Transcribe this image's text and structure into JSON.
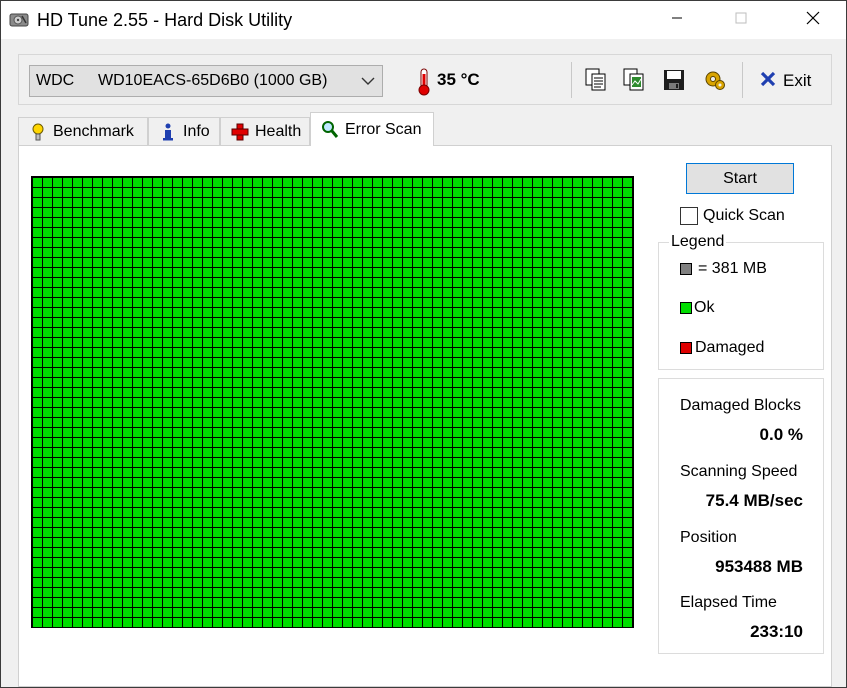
{
  "window": {
    "title": "HD Tune 2.55 - Hard Disk Utility"
  },
  "toolbar": {
    "drive_vendor": "WDC",
    "drive_model": "WD10EACS-65D6B0 (1000 GB)",
    "temperature": "35 °C",
    "exit_label": "Exit",
    "icons": [
      "copy-text-icon",
      "copy-screenshot-icon",
      "save-icon",
      "options-icon"
    ]
  },
  "tabs": [
    {
      "label": "Benchmark",
      "icon": "benchmark-icon"
    },
    {
      "label": "Info",
      "icon": "info-icon"
    },
    {
      "label": "Health",
      "icon": "health-icon"
    },
    {
      "label": "Error Scan",
      "icon": "magnifier-icon",
      "active": true
    }
  ],
  "scan": {
    "start_label": "Start",
    "quick_scan_label": "Quick Scan",
    "quick_scan_checked": false,
    "block_state": "ok"
  },
  "legend": {
    "title": "Legend",
    "items": [
      {
        "label": "= 381 MB",
        "color": "#808080"
      },
      {
        "label": "Ok",
        "color": "#00dd00"
      },
      {
        "label": "Damaged",
        "color": "#dd0000"
      }
    ]
  },
  "stats": {
    "damaged_blocks_label": "Damaged Blocks",
    "damaged_blocks_value": "0.0 %",
    "scanning_speed_label": "Scanning Speed",
    "scanning_speed_value": "75.4 MB/sec",
    "position_label": "Position",
    "position_value": "953488 MB",
    "elapsed_time_label": "Elapsed Time",
    "elapsed_time_value": "233:10"
  },
  "colors": {
    "ok_block": "#00dd00",
    "accent_border": "#0078d7"
  }
}
